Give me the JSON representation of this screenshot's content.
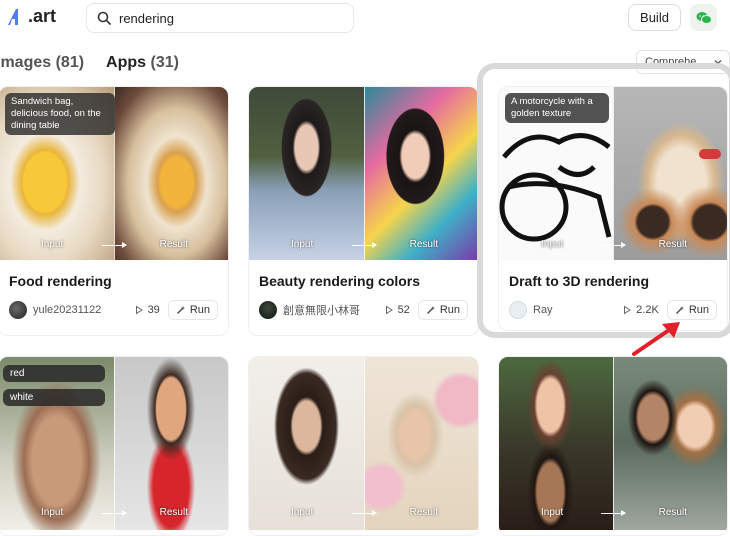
{
  "header": {
    "logo_text": ".art",
    "search_value": "rendering",
    "build_label": "Build",
    "wechat_icon": "wechat-icon"
  },
  "tabs": {
    "images_label": "Images",
    "images_count": "(81)",
    "apps_label": "Apps",
    "apps_count": "(31)",
    "sort_label": "Comprehe..."
  },
  "cards": [
    {
      "title": "Food rendering",
      "prompt": "Sandwich bag, delicious food, on the dining table",
      "author": "yule20231122",
      "runs": "39",
      "run_label": "Run",
      "input_label": "Input",
      "result_label": "Result"
    },
    {
      "title": "Beauty rendering colors",
      "author": "創意無限小林哥",
      "runs": "52",
      "run_label": "Run",
      "input_label": "Input",
      "result_label": "Result"
    },
    {
      "title": "Draft to 3D rendering",
      "prompt": "A motorcycle with a golden texture",
      "author": "Ray",
      "runs": "2.2K",
      "run_label": "Run",
      "input_label": "Input",
      "result_label": "Result"
    },
    {
      "tags": [
        "red",
        "white"
      ],
      "input_label": "Input",
      "result_label": "Result"
    },
    {
      "input_label": "Input",
      "result_label": "Result"
    },
    {
      "input_label": "Input",
      "result_label": "Result"
    }
  ],
  "colors": {
    "brand": "#6b4cff",
    "highlight_frame": "#d9d9d9",
    "annotation_arrow": "#e0202a"
  }
}
